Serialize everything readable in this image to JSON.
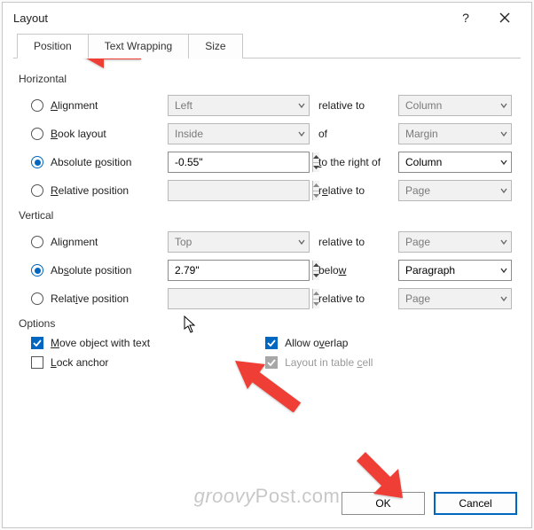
{
  "window": {
    "title": "Layout"
  },
  "tabs": {
    "position": "Position",
    "wrap": "Text Wrapping",
    "size": "Size"
  },
  "section_horizontal": "Horizontal",
  "section_vertical": "Vertical",
  "section_options": "Options",
  "hAlign": {
    "label_pre": "",
    "label_u": "A",
    "label_post": "lignment",
    "value": "Left",
    "rel_label": "relative to",
    "target": "Column"
  },
  "hBook": {
    "label_pre": "",
    "label_u": "B",
    "label_post": "ook layout",
    "value": "Inside",
    "rel_label": "of",
    "target": "Margin"
  },
  "hAbs": {
    "label_pre": "Absolute ",
    "label_u": "p",
    "label_post": "osition",
    "value": "-0.55\"",
    "rel_pre": "",
    "rel_u": "t",
    "rel_post": "o the right of",
    "target": "Column"
  },
  "hRel": {
    "label_pre": "",
    "label_u": "R",
    "label_post": "elative position",
    "value": "",
    "rel_pre": "r",
    "rel_u": "e",
    "rel_post": "lative to",
    "target": "Page"
  },
  "vAlign": {
    "label_pre": "Ali",
    "label_u": "g",
    "label_post": "nment",
    "value": "Top",
    "rel_label": "relative to",
    "target": "Page"
  },
  "vAbs": {
    "label_pre": "Ab",
    "label_u": "s",
    "label_post": "olute position",
    "value": "2.79\"",
    "rel_pre": "belo",
    "rel_u": "w",
    "rel_post": "",
    "target": "Paragraph"
  },
  "vRel": {
    "label_pre": "Relat",
    "label_u": "i",
    "label_post": "ve position",
    "value": "",
    "rel_label": "relative to",
    "target": "Page"
  },
  "opts": {
    "move_pre": "",
    "move_u": "M",
    "move_post": "ove object with text",
    "lock_pre": "",
    "lock_u": "L",
    "lock_post": "ock anchor",
    "overlap_pre": "Allow o",
    "overlap_u": "v",
    "overlap_post": "erlap",
    "cell_pre": "Layout in table ",
    "cell_u": "c",
    "cell_post": "ell"
  },
  "buttons": {
    "ok": "OK",
    "cancel": "Cancel"
  },
  "watermark": {
    "a": "groovy",
    "b": "Post",
    "c": ".com"
  }
}
